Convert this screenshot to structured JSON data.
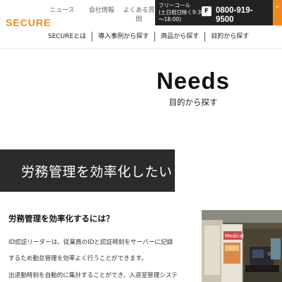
{
  "brand": {
    "logo_text": "SECURE",
    "accent_color": "#f18a1c"
  },
  "top_nav": {
    "news": "ニュース",
    "company": "会社情報",
    "faq": "よくある質問"
  },
  "phone": {
    "label_line1": "フリーコール",
    "label_line2": "(土日祝日除く9:30",
    "label_line3": "〜18:00)",
    "icon_text": "F",
    "number_line1": "0800-919-",
    "number_line2": "9500"
  },
  "menu_toggle_icon": "chevron-down-icon",
  "main_nav": {
    "items": [
      "SECUREとは",
      "導入事例から探す",
      "商品から探す",
      "目的から探す"
    ]
  },
  "hero": {
    "title": "Needs",
    "subtitle": "目的から探す"
  },
  "banner": {
    "text": "労務管理を効率化したい"
  },
  "section": {
    "heading": "労務管理を効率化するには？",
    "lines": [
      "ID認証リーダーは、従業員のIDと認証時刻をサーバーに記録",
      "するため勤怠管理を効率よく行うことができます。",
      "出退勤時刻を自動的に集計することができ、入退室管理システ"
    ]
  },
  "photo": {
    "sign_text": "Medical"
  }
}
